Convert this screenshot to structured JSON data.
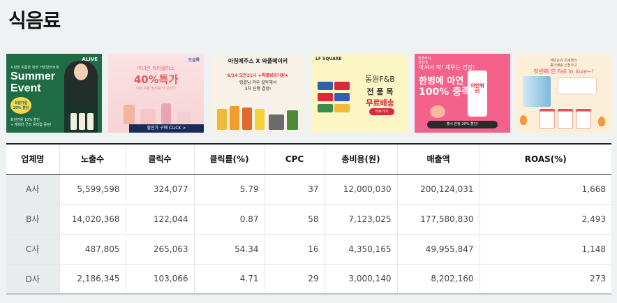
{
  "page": {
    "title": "식음료"
  },
  "banners": [
    {
      "brand": "ALIVE",
      "sub": "시원한 여름을 위한 어임알러브에",
      "headline1": "Summer",
      "headline2": "Event",
      "badge": "회원가입 10% 할인",
      "desc1": "회원전용 10% 할인",
      "desc2": "+ 캐릭터 굿즈 유리컵 증정!"
    },
    {
      "brand": "오설록",
      "line1": "미녀린 워터플러스",
      "line2": "40%특가",
      "line3": "이번 여름 필수템 다 모았다",
      "cta": "할인가 구매 CLICK >"
    },
    {
      "line1": "아침에주스 X 와플메이커",
      "line2": "6/14 오전11시 ★특별성공기원★",
      "line3": "링결님 겨우 설득해서",
      "line4": "3차 진행 결정!"
    },
    {
      "brand": "LF SQUARE",
      "line1": "동원F&B",
      "line2": "전 품 목",
      "line3": "무료배송",
      "button": "바로가기"
    },
    {
      "brand1": "썬앤무지",
      "brand2": "한방에",
      "line1": "마셔서 꽉! 채우는 건강!",
      "line2": "한병에 아연",
      "line3": "100% 충족",
      "product": "아연워터",
      "cta": "출시 한정 20% 할인!"
    },
    {
      "line1": "에빈슨슈 전세행인",
      "line2": "종가배송 신청하고",
      "line3": "첫번째 인 Fall in love~!"
    }
  ],
  "table": {
    "headers": [
      "업체명",
      "노출수",
      "클릭수",
      "클릭률(%)",
      "CPC",
      "총비용(원)",
      "매출액",
      "ROAS(%)"
    ],
    "rows": [
      [
        "A사",
        "5,599,598",
        "324,077",
        "5.79",
        "37",
        "12,000,030",
        "200,124,031",
        "1,668"
      ],
      [
        "B사",
        "14,020,368",
        "122,044",
        "0.87",
        "58",
        "7,123,025",
        "177,580,830",
        "2,493"
      ],
      [
        "C사",
        "487,805",
        "265,063",
        "54.34",
        "16",
        "4,350,165",
        "49,955,847",
        "1,148"
      ],
      [
        "D사",
        "2,186,345",
        "103,066",
        "4.71",
        "29",
        "3,000,140",
        "8,202,160",
        "273"
      ]
    ]
  }
}
